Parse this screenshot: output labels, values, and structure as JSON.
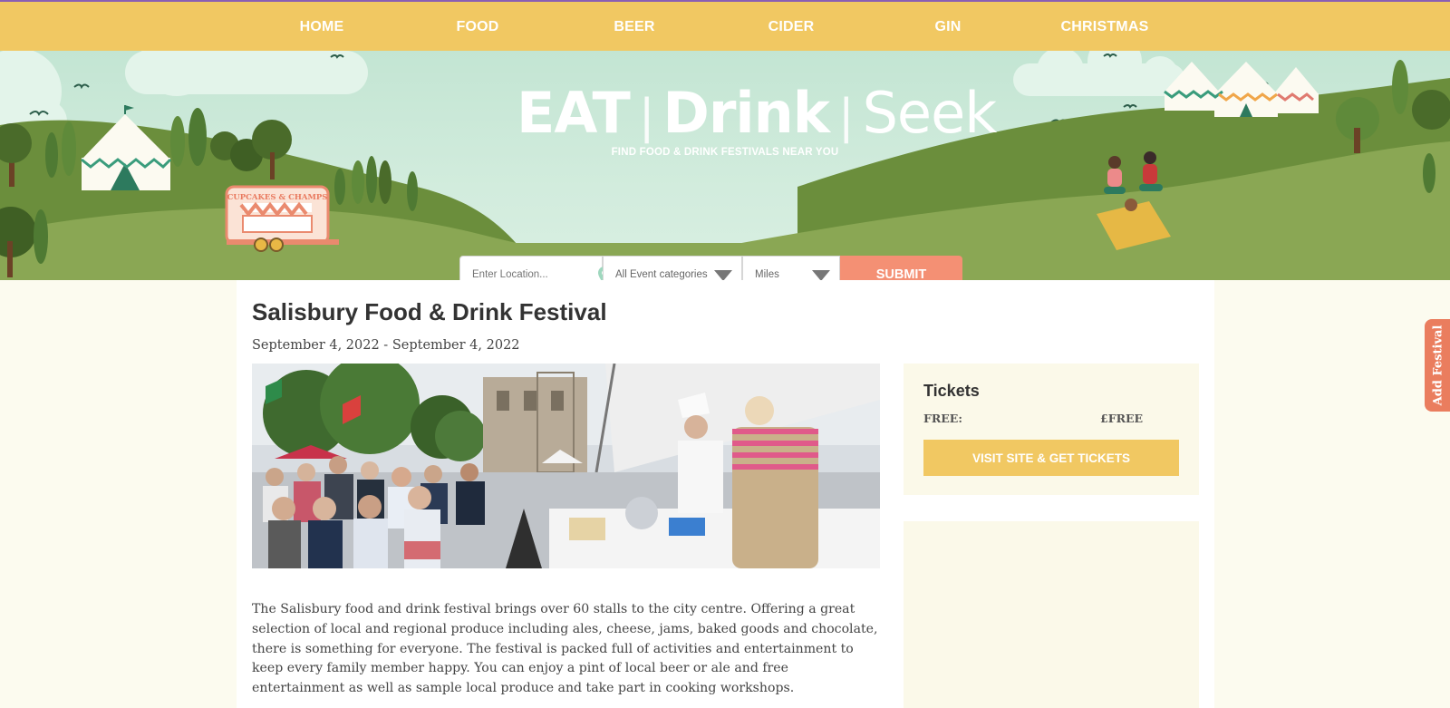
{
  "nav": {
    "items": [
      "HOME",
      "FOOD",
      "BEER",
      "CIDER",
      "GIN",
      "CHRISTMAS"
    ]
  },
  "header": {
    "logo": {
      "eat": "EAT",
      "drink": "Drink",
      "seek": "Seek"
    },
    "tagline": "FIND FOOD & DRINK FESTIVALS NEAR YOU",
    "van_sign": "CUPCAKES & CHAMPS"
  },
  "search": {
    "location_placeholder": "Enter Location...",
    "category_value": "All Event categories",
    "miles_value": "Miles",
    "submit_label": "SUBMIT"
  },
  "event": {
    "title": "Salisbury Food & Drink Festival",
    "dates": "September 4, 2022 - September 4, 2022",
    "description": "The Salisbury food and drink festival brings over 60 stalls to the city centre. Offering a great selection of local and regional produce including ales, cheese, jams, baked goods and chocolate, there is something for everyone. The festival is packed full of activities and entertainment to keep every family member happy. You can enjoy a pint of local beer or ale and free entertainment as well as sample local produce and take part in cooking workshops."
  },
  "tickets": {
    "heading": "Tickets",
    "label": "FREE:",
    "price": "£FREE",
    "button_label": "VISIT SITE & GET TICKETS"
  },
  "side_tab": {
    "label": "Add Festival"
  },
  "colors": {
    "nav_bg": "#f1c862",
    "accent_orange": "#f49074",
    "hill_green": "#8aa754",
    "page_bg": "#fcfbef"
  }
}
